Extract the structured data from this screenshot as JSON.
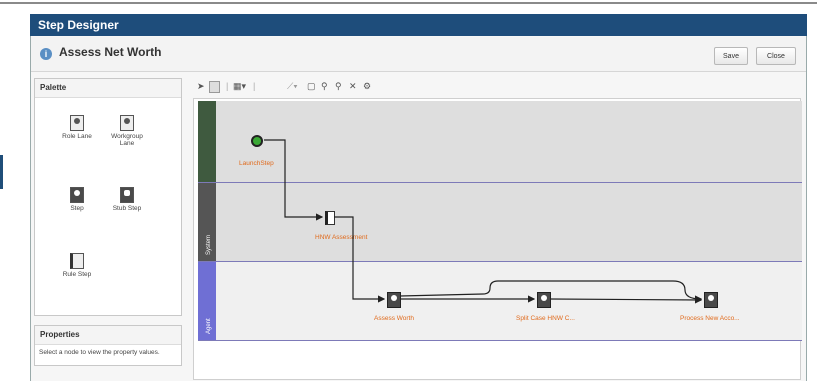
{
  "window": {
    "title": "Step Designer"
  },
  "header": {
    "title": "Assess Net Worth",
    "save_label": "Save",
    "close_label": "Close"
  },
  "palette": {
    "title": "Palette",
    "items": [
      {
        "label": "Role Lane",
        "icon": "role-lane-icon"
      },
      {
        "label": "Workgroup Lane",
        "icon": "workgroup-lane-icon"
      },
      {
        "label": "Step",
        "icon": "step-icon"
      },
      {
        "label": "Stub Step",
        "icon": "stub-step-icon"
      },
      {
        "label": "Rule Step",
        "icon": "rule-step-icon"
      }
    ]
  },
  "properties": {
    "title": "Properties",
    "hint": "Select a node to view the property values."
  },
  "toolbar": {
    "icons": [
      "pointer-icon",
      "marquee-select-icon",
      "layout-icon",
      "link-tool-icon",
      "fit-icon",
      "zoom-in-icon",
      "zoom-out-icon",
      "delete-icon",
      "settings-icon"
    ]
  },
  "lanes": [
    {
      "label": "",
      "color": "#3f5a3f"
    },
    {
      "label": "System",
      "color": "#555555"
    },
    {
      "label": "Agent",
      "color": "#6f6fd4"
    }
  ],
  "nodes": {
    "launch": "LaunchStep",
    "hnw": "HNW Assessment",
    "assess": "Assess Worth",
    "split": "Split Case HNW C...",
    "process": "Process New Acco..."
  },
  "colors": {
    "titlebar": "#1e4d7b",
    "node_label": "#e06a1c",
    "start": "#3aa835"
  }
}
